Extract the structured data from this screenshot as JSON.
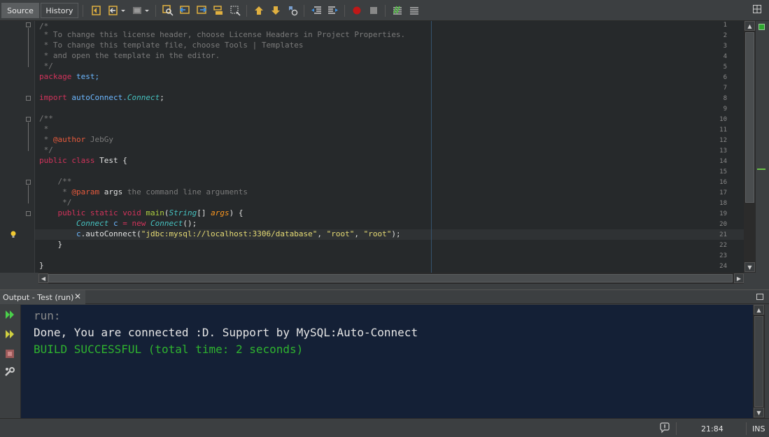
{
  "toolbar": {
    "source_label": "Source",
    "history_label": "History",
    "icons": [
      "last-edit-icon",
      "back-icon",
      "forward-icon",
      "find-selection-icon",
      "find-previous-icon",
      "find-next-icon",
      "toggle-highlight-icon",
      "toggle-rect-select-icon",
      "prev-bookmark-icon",
      "next-bookmark-icon",
      "toggle-bookmark-icon",
      "shift-left-icon",
      "shift-right-icon",
      "start-macro-icon",
      "stop-macro-icon",
      "comment-icon",
      "uncomment-icon",
      "split-window-icon"
    ]
  },
  "editor": {
    "line_numbers": [
      "1",
      "2",
      "3",
      "4",
      "5",
      "6",
      "7",
      "8",
      "9",
      "10",
      "11",
      "12",
      "13",
      "14",
      "15",
      "16",
      "17",
      "18",
      "19",
      "20",
      "21",
      "22",
      "23",
      "24"
    ],
    "lines": {
      "l1": "/*",
      "l2": " * To change this license header, choose License Headers in Project Properties.",
      "l3": " * To change this template file, choose Tools | Templates",
      "l4": " * and open the template in the editor.",
      "l5": " */",
      "l6_kw": "package",
      "l6_rest": " test;",
      "l8_kw": "import",
      "l8_pkg": " autoConnect.",
      "l8_cls": "Connect",
      "l8_end": ";",
      "l10": "/**",
      "l11": " *",
      "l12_pre": " * ",
      "l12_tag": "@author",
      "l12_rest": " JebGy",
      "l13": " */",
      "l14_kw": "public class",
      "l14_rest": " Test {",
      "l16": "    /**",
      "l17_pre": "     * ",
      "l17_tag": "@param",
      "l17_arg": " args",
      "l17_rest": " the command line arguments",
      "l18": "     */",
      "l19_kw": "    public static void",
      "l19_fn": " main",
      "l19_p1": "(",
      "l19_type": "String",
      "l19_p2": "[] ",
      "l19_arg": "args",
      "l19_p3": ") {",
      "l20_type": "        Connect",
      "l20_var": " c",
      "l20_eq": " = ",
      "l20_new": "new",
      "l20_cls": " Connect",
      "l20_end": "();",
      "l21_obj": "        c",
      "l21_call": ".autoConnect(",
      "l21_s1": "\"jdbc:mysql://localhost:3306/database\"",
      "l21_c1": ", ",
      "l21_s2": "\"root\"",
      "l21_c2": ", ",
      "l21_s3": "\"root\"",
      "l21_end": ");",
      "l22": "    }",
      "l24": "}"
    }
  },
  "output": {
    "tab_label": "Output - Test (run)",
    "close_glyph": "✕",
    "lines": {
      "run": "run:",
      "message": "Done, You are connected :D. Support by MySQL:Auto-Connect",
      "build": "BUILD SUCCESSFUL (total time: 2 seconds)"
    }
  },
  "status": {
    "position": "21:84",
    "mode": "INS"
  },
  "colors": {
    "keyword": "#d2335b",
    "comment": "#7a7a7a",
    "string": "#e6db74",
    "output_bg": "#142036",
    "build_success": "#2fb32f"
  }
}
